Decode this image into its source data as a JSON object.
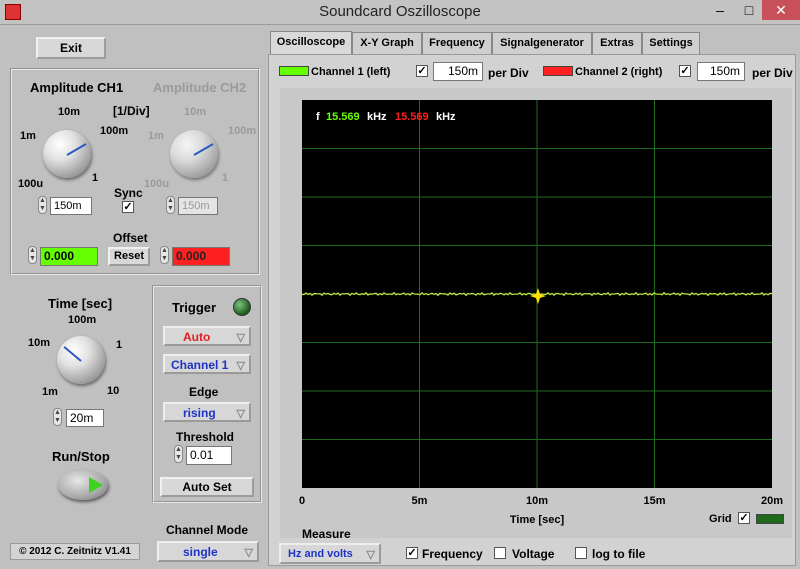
{
  "window": {
    "title": "Soundcard Oszilloscope"
  },
  "left": {
    "exit_label": "Exit",
    "amp_ch1_title": "Amplitude CH1",
    "amp_ch2_title": "Amplitude CH2",
    "div_label": "[1/Div]",
    "amp_scale": {
      "s10m": "10m",
      "s100m": "100m",
      "s1m": "1m",
      "s1": "1",
      "s100u": "100u"
    },
    "ch1_value": "150m",
    "ch2_value": "150m",
    "sync_label": "Sync",
    "offset_label": "Offset",
    "offset_ch1": "0.000",
    "offset_ch2": "0.000",
    "reset_label": "Reset",
    "time_title": "Time [sec]",
    "time_scale": {
      "t100m": "100m",
      "t10m": "10m",
      "t1": "1",
      "t1m": "1m",
      "t10": "10"
    },
    "time_value": "20m",
    "runstop_label": "Run/Stop",
    "copyright": "© 2012  C. Zeitnitz V1.41",
    "channel_mode_label": "Channel Mode",
    "channel_mode_value": "single"
  },
  "trigger": {
    "title": "Trigger",
    "mode": "Auto",
    "channel": "Channel 1",
    "edge_label": "Edge",
    "edge_value": "rising",
    "threshold_label": "Threshold",
    "threshold_value": "0.01",
    "autoset_label": "Auto Set"
  },
  "tabs": [
    "Oscilloscope",
    "X-Y Graph",
    "Frequency",
    "Signalgenerator",
    "Extras",
    "Settings"
  ],
  "channels": {
    "ch1_label": "Channel 1 (left)",
    "ch1_value": "150m",
    "ch2_label": "Channel 2 (right)",
    "ch2_value": "150m",
    "per_div": "per Div"
  },
  "scope": {
    "f_label": "f",
    "freq1": "15.569",
    "freq2": "15.569",
    "unit": "kHz",
    "x_ticks": [
      "0",
      "5m",
      "10m",
      "15m",
      "20m"
    ],
    "x_label": "Time [sec]",
    "grid_label": "Grid"
  },
  "measure": {
    "label": "Measure",
    "select": "Hz and volts",
    "frequency": "Frequency",
    "voltage": "Voltage",
    "log": "log to file"
  },
  "colors": {
    "ch1": "#66ff00",
    "ch2": "#ff2020",
    "plot_bg": "#000000",
    "grid": "#1e6b1e",
    "trace": "#c8e84a"
  }
}
